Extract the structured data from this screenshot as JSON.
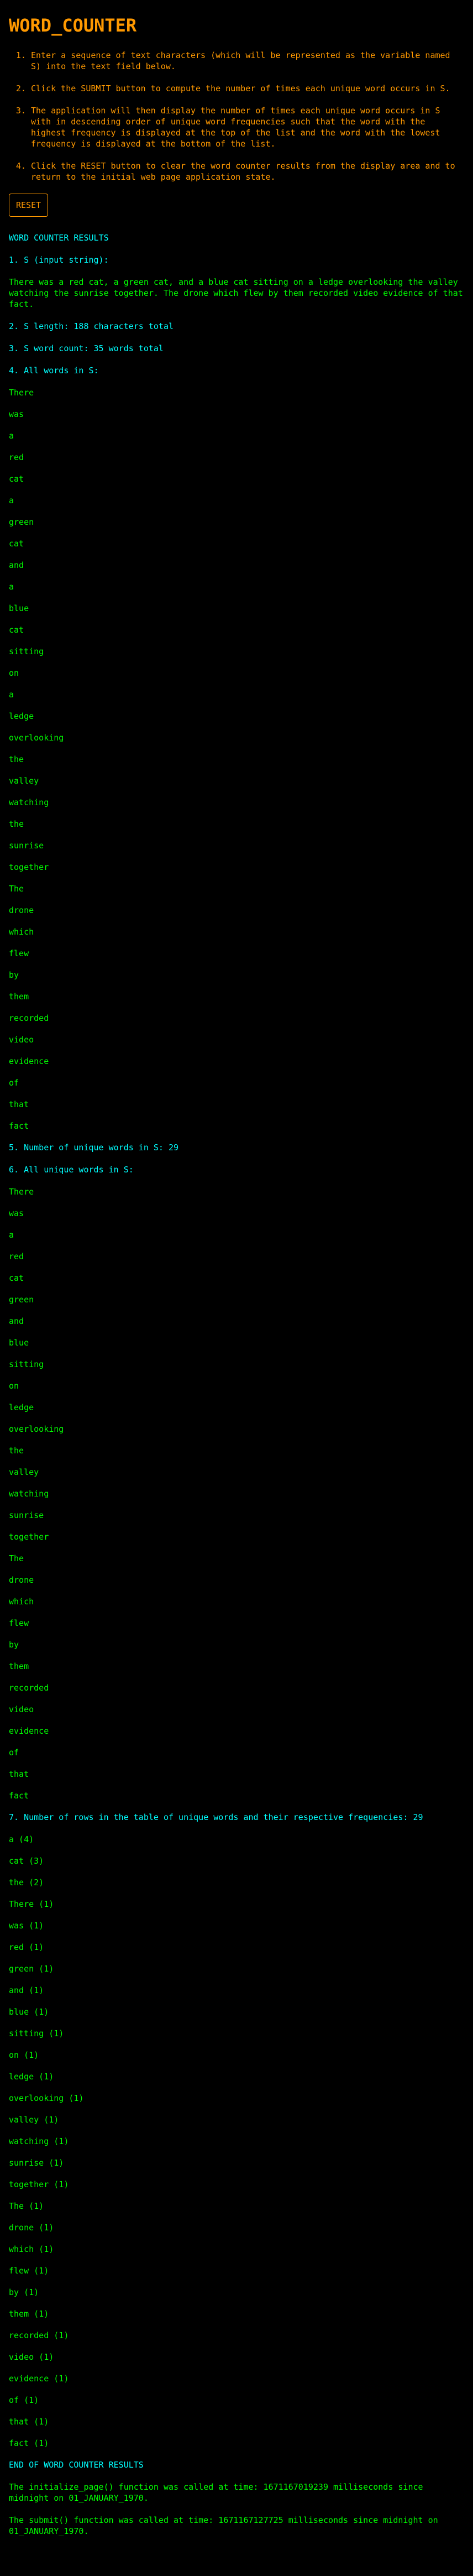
{
  "app": {
    "title": "WORD_COUNTER"
  },
  "instructions": [
    "Enter a sequence of text characters (which will be represented as the variable named S) into the text field below.",
    "Click the SUBMIT button to compute the number of times each unique word occurs in S.",
    "The application will then display the number of times each unique word occurs in S with in descending order of unique word frequencies such that the word with the highest frequency is displayed at the top of the list and the word with the lowest frequency is displayed at the bottom of the list.",
    "Click the RESET button to clear the word counter results from the display area and to return to the initial web page application state."
  ],
  "reset_button": {
    "label": "RESET"
  },
  "results": {
    "heading": "WORD COUNTER RESULTS",
    "input_label": "1. S (input string):",
    "input_string": "There was a red cat, a green cat, and a blue cat sitting on a ledge overlooking the valley watching the sunrise together. The drone which flew by them recorded video evidence of that fact.",
    "length_label": "2. S length: 188 characters total",
    "word_count_label": "3. S word count: 35 words total",
    "all_words_label": "4. All words in S:",
    "all_words": [
      "There",
      "was",
      "a",
      "red",
      "cat",
      "a",
      "green",
      "cat",
      "and",
      "a",
      "blue",
      "cat",
      "sitting",
      "on",
      "a",
      "ledge",
      "overlooking",
      "the",
      "valley",
      "watching",
      "the",
      "sunrise",
      "together",
      "The",
      "drone",
      "which",
      "flew",
      "by",
      "them",
      "recorded",
      "video",
      "evidence",
      "of",
      "that",
      "fact"
    ],
    "unique_count_label": "5. Number of unique words in S: 29",
    "unique_words_label": "6. All unique words in S:",
    "unique_words": [
      "There",
      "was",
      "a",
      "red",
      "cat",
      "green",
      "and",
      "blue",
      "sitting",
      "on",
      "ledge",
      "overlooking",
      "the",
      "valley",
      "watching",
      "sunrise",
      "together",
      "The",
      "drone",
      "which",
      "flew",
      "by",
      "them",
      "recorded",
      "video",
      "evidence",
      "of",
      "that",
      "fact"
    ],
    "freq_table_label": "7. Number of rows in the table of unique words and their respective frequencies: 29",
    "frequencies": [
      "a (4)",
      "cat (3)",
      "the (2)",
      "There (1)",
      "was (1)",
      "red (1)",
      "green (1)",
      "and (1)",
      "blue (1)",
      "sitting (1)",
      "on (1)",
      "ledge (1)",
      "overlooking (1)",
      "valley (1)",
      "watching (1)",
      "sunrise (1)",
      "together (1)",
      "The (1)",
      "drone (1)",
      "which (1)",
      "flew (1)",
      "by (1)",
      "them (1)",
      "recorded (1)",
      "video (1)",
      "evidence (1)",
      "of (1)",
      "that (1)",
      "fact (1)"
    ],
    "end_heading": "END OF WORD COUNTER RESULTS"
  },
  "footer": {
    "initialize_note": "The initialize_page() function was called at time: 1671167019239 milliseconds since midnight on 01_JANUARY_1970.",
    "submit_note": "The submit() function was called at time: 1671167127725 milliseconds since midnight on 01_JANUARY_1970."
  }
}
